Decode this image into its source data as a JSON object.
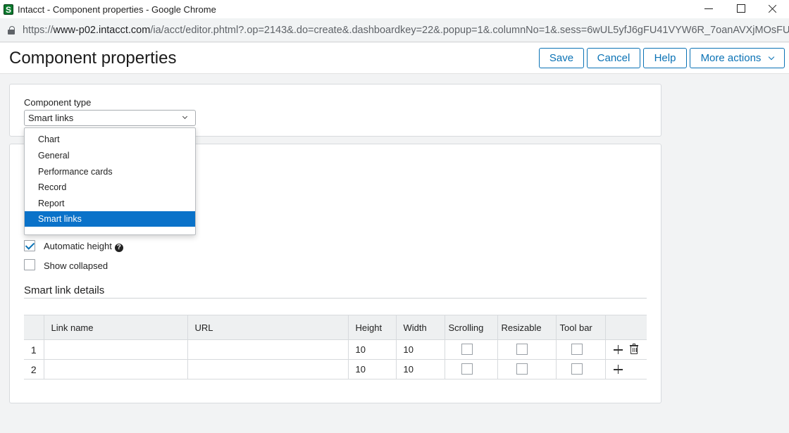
{
  "browser": {
    "window_title": "Intacct - Component properties - Google Chrome",
    "app_icon_letter": "S",
    "url_scheme": "https://",
    "url_host": "www-p02.intacct.com",
    "url_path": "/ia/acct/editor.phtml?.op=2143&.do=create&.dashboardkey=22&.popup=1&.columnNo=1&.sess=6wUL5yfJ6gFU41VYW6R_7oanAVXjMOsFUDzC1r..."
  },
  "header": {
    "title": "Component properties",
    "buttons": {
      "save": "Save",
      "cancel": "Cancel",
      "help": "Help",
      "more_actions": "More actions"
    }
  },
  "component_type": {
    "label": "Component type",
    "selected": "Smart links",
    "options": [
      "Chart",
      "General",
      "Performance cards",
      "Record",
      "Report",
      "Smart links"
    ]
  },
  "options": {
    "automatic_height": "Automatic height",
    "automatic_height_checked": true,
    "show_collapsed": "Show collapsed",
    "show_collapsed_checked": false
  },
  "details": {
    "section_title": "Smart link details",
    "columns": [
      "",
      "Link name",
      "URL",
      "Height",
      "Width",
      "Scrolling",
      "Resizable",
      "Tool bar",
      ""
    ],
    "rows": [
      {
        "num": "1",
        "link_name": "",
        "url": "",
        "height": "10",
        "width": "10",
        "scrolling": false,
        "resizable": false,
        "toolbar": false
      },
      {
        "num": "2",
        "link_name": "",
        "url": "",
        "height": "10",
        "width": "10",
        "scrolling": false,
        "resizable": false,
        "toolbar": false
      }
    ]
  },
  "icons": {
    "help": "question-circle-icon",
    "add_row": "plus-icon",
    "delete_row": "trash-icon"
  },
  "colors": {
    "accent": "#0a72b5",
    "selected_option": "#0a72c9"
  }
}
